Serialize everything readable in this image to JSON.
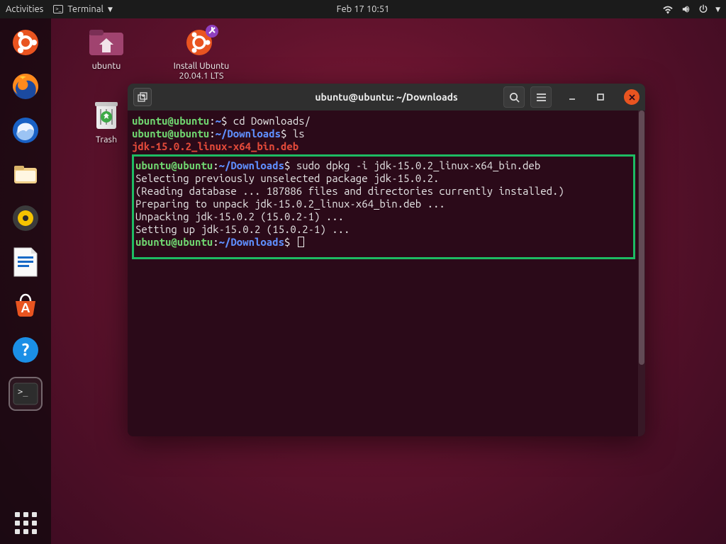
{
  "topbar": {
    "activities": "Activities",
    "app_label": "Terminal",
    "datetime": "Feb 17  10:51"
  },
  "desktop": {
    "home_label": "ubuntu",
    "installer_label_line1": "Install Ubuntu",
    "installer_label_line2": "20.04.1 LTS",
    "trash_label": "Trash"
  },
  "dock": {
    "items": [
      "ubuntu-cof",
      "firefox",
      "thunderbird",
      "files",
      "rhythmbox",
      "libreoffice-writer",
      "software-center",
      "help",
      "terminal"
    ]
  },
  "terminal": {
    "title": "ubuntu@ubuntu: ~/Downloads",
    "lines": {
      "p1_user": "ubuntu@ubuntu",
      "p1_path": "~",
      "p1_cmd": "cd Downloads/",
      "p2_user": "ubuntu@ubuntu",
      "p2_path": "~/Downloads",
      "p2_cmd": "ls",
      "ls_out": "jdk-15.0.2_linux-x64_bin.deb",
      "p3_user": "ubuntu@ubuntu",
      "p3_path": "~/Downloads",
      "p3_cmd": "sudo dpkg -i jdk-15.0.2_linux-x64_bin.deb",
      "o1": "Selecting previously unselected package jdk-15.0.2.",
      "o2": "(Reading database ... 187886 files and directories currently installed.)",
      "o3": "Preparing to unpack jdk-15.0.2_linux-x64_bin.deb ...",
      "o4": "Unpacking jdk-15.0.2 (15.0.2-1) ...",
      "o5": "Setting up jdk-15.0.2 (15.0.2-1) ...",
      "p4_user": "ubuntu@ubuntu",
      "p4_path": "~/Downloads"
    }
  }
}
